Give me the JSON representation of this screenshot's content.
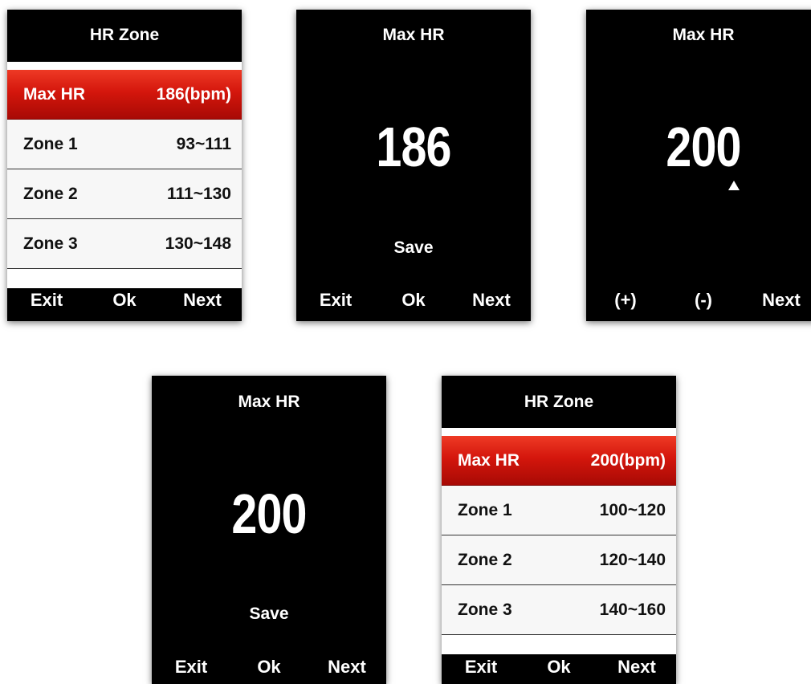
{
  "screens": [
    {
      "title": "HR Zone",
      "rows": [
        {
          "label": "Max HR",
          "value": "186(bpm)"
        },
        {
          "label": "Zone 1",
          "value": "93~111"
        },
        {
          "label": "Zone 2",
          "value": "111~130"
        },
        {
          "label": "Zone 3",
          "value": "130~148"
        }
      ],
      "buttons": {
        "left": "Exit",
        "middle": "Ok",
        "right": "Next"
      }
    },
    {
      "title": "Max HR",
      "value": "186",
      "save": "Save",
      "buttons": {
        "left": "Exit",
        "middle": "Ok",
        "right": "Next"
      }
    },
    {
      "title": "Max HR",
      "value": "200",
      "buttons": {
        "left": "(+)",
        "middle": "(-)",
        "right": "Next"
      }
    },
    {
      "title": "Max HR",
      "value": "200",
      "save": "Save",
      "buttons": {
        "left": "Exit",
        "middle": "Ok",
        "right": "Next"
      }
    },
    {
      "title": "HR Zone",
      "rows": [
        {
          "label": "Max HR",
          "value": "200(bpm)"
        },
        {
          "label": "Zone 1",
          "value": "100~120"
        },
        {
          "label": "Zone 2",
          "value": "120~140"
        },
        {
          "label": "Zone 3",
          "value": "140~160"
        }
      ],
      "buttons": {
        "left": "Exit",
        "middle": "Ok",
        "right": "Next"
      }
    }
  ],
  "colors": {
    "selected_row": "#d4160c",
    "screen_bg": "#000000",
    "list_bg": "#f7f7f7"
  },
  "icons": {
    "caret": "up-triangle-icon"
  }
}
